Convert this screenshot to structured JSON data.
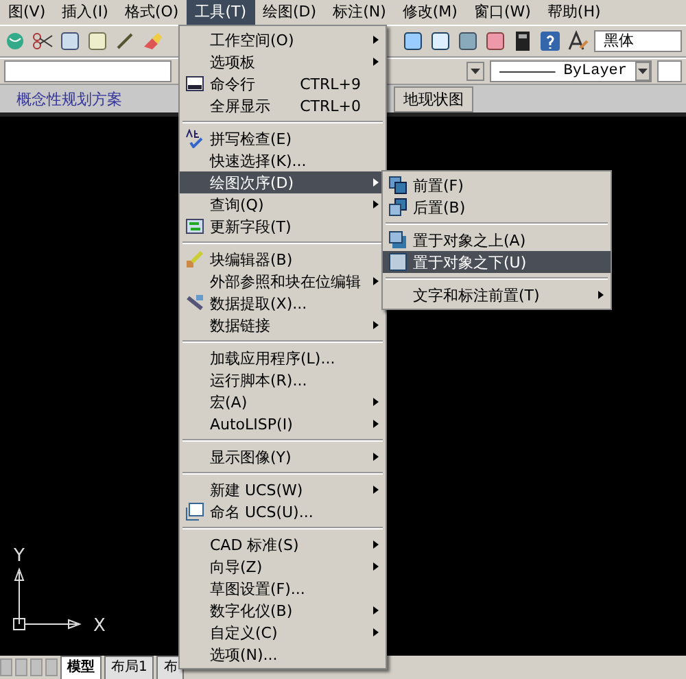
{
  "menu_bar": [
    {
      "label": "图(V)",
      "selected": false
    },
    {
      "label": "插入(I)",
      "selected": false
    },
    {
      "label": "格式(O)",
      "selected": false
    },
    {
      "label": "工具(T)",
      "selected": true
    },
    {
      "label": "绘图(D)",
      "selected": false
    },
    {
      "label": "标注(N)",
      "selected": false
    },
    {
      "label": "修改(M)",
      "selected": false
    },
    {
      "label": "窗口(W)",
      "selected": false
    },
    {
      "label": "帮助(H)",
      "selected": false
    }
  ],
  "toolbar": {
    "font_field": "黑体",
    "linetype_dropdown": "ByLayer"
  },
  "document_tabs": [
    {
      "label": "概念性规划方案"
    },
    {
      "label": "地现状图"
    }
  ],
  "tools_menu": {
    "groups": [
      [
        {
          "label": "工作空间(O)",
          "submenu": true,
          "selected": false
        },
        {
          "label": "选项板",
          "submenu": true,
          "selected": false
        },
        {
          "label": "命令行",
          "shortcut": "CTRL+9",
          "submenu": false,
          "selected": false
        },
        {
          "label": "全屏显示",
          "shortcut": "CTRL+0",
          "submenu": false,
          "selected": false
        }
      ],
      [
        {
          "label": "拼写检查(E)",
          "submenu": false,
          "selected": false
        },
        {
          "label": "快速选择(K)...",
          "submenu": false,
          "selected": false
        },
        {
          "label": "绘图次序(D)",
          "submenu": true,
          "selected": true
        },
        {
          "label": "查询(Q)",
          "submenu": true,
          "selected": false
        },
        {
          "label": "更新字段(T)",
          "submenu": false,
          "selected": false
        }
      ],
      [
        {
          "label": "块编辑器(B)",
          "submenu": false,
          "selected": false
        },
        {
          "label": "外部参照和块在位编辑",
          "submenu": true,
          "selected": false
        },
        {
          "label": "数据提取(X)...",
          "submenu": false,
          "selected": false
        },
        {
          "label": "数据链接",
          "submenu": true,
          "selected": false
        }
      ],
      [
        {
          "label": "加载应用程序(L)...",
          "submenu": false,
          "selected": false
        },
        {
          "label": "运行脚本(R)...",
          "submenu": false,
          "selected": false
        },
        {
          "label": "宏(A)",
          "submenu": true,
          "selected": false
        },
        {
          "label": "AutoLISP(I)",
          "submenu": true,
          "selected": false
        }
      ],
      [
        {
          "label": "显示图像(Y)",
          "submenu": true,
          "selected": false
        }
      ],
      [
        {
          "label": "新建 UCS(W)",
          "submenu": true,
          "selected": false
        },
        {
          "label": "命名 UCS(U)...",
          "submenu": false,
          "selected": false
        }
      ],
      [
        {
          "label": "CAD 标准(S)",
          "submenu": true,
          "selected": false
        },
        {
          "label": "向导(Z)",
          "submenu": true,
          "selected": false
        },
        {
          "label": "草图设置(F)...",
          "submenu": false,
          "selected": false
        },
        {
          "label": "数字化仪(B)",
          "submenu": true,
          "selected": false
        },
        {
          "label": "自定义(C)",
          "submenu": true,
          "selected": false
        },
        {
          "label": "选项(N)...",
          "submenu": false,
          "selected": false
        }
      ]
    ]
  },
  "draw_order_submenu": {
    "groups": [
      [
        {
          "label": "前置(F)",
          "submenu": false,
          "selected": false
        },
        {
          "label": "后置(B)",
          "submenu": false,
          "selected": false
        }
      ],
      [
        {
          "label": "置于对象之上(A)",
          "submenu": false,
          "selected": false
        },
        {
          "label": "置于对象之下(U)",
          "submenu": false,
          "selected": true
        }
      ],
      [
        {
          "label": "文字和标注前置(T)",
          "submenu": true,
          "selected": false
        }
      ]
    ]
  },
  "ucs_icon": {
    "x_label": "X",
    "y_label": "Y"
  },
  "layout_tabs": [
    {
      "label": "模型",
      "selected": true
    },
    {
      "label": "布局1",
      "selected": false
    },
    {
      "label": "布",
      "selected": false
    }
  ]
}
